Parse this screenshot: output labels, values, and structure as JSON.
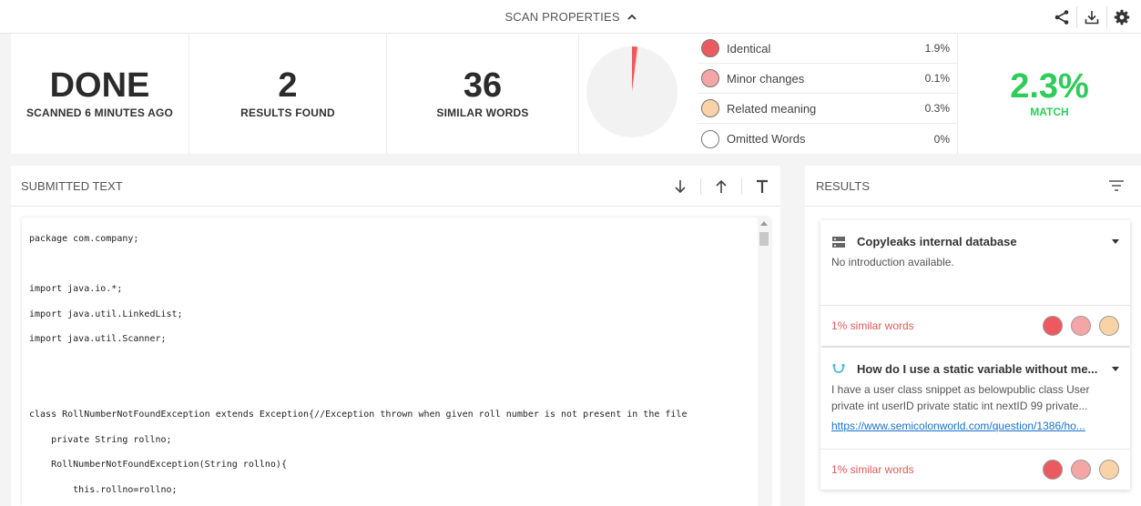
{
  "topbar": {
    "title": "SCAN PROPERTIES",
    "chevron_icon": "chevron-up-icon",
    "actions": [
      "share-icon",
      "download-icon",
      "gear-icon"
    ]
  },
  "stats": {
    "status": {
      "value": "DONE",
      "label": "SCANNED 6 MINUTES AGO"
    },
    "results": {
      "value": "2",
      "label": "RESULTS FOUND"
    },
    "words": {
      "value": "36",
      "label": "SIMILAR WORDS"
    },
    "match": {
      "value": "2.3%",
      "label": "MATCH",
      "color": "#2ecc5a"
    }
  },
  "chart_data": {
    "type": "pie",
    "categories": [
      "Identical",
      "Minor changes",
      "Related meaning",
      "Omitted Words"
    ],
    "values": [
      1.9,
      0.1,
      0.3,
      0
    ],
    "colors": [
      "#ec5a5f",
      "#f4a5a5",
      "#f8d3a6",
      "#ffffff"
    ],
    "title": ""
  },
  "legend": [
    {
      "label": "Identical",
      "pct": "1.9%",
      "color": "#ec5a5f"
    },
    {
      "label": "Minor changes",
      "pct": "0.1%",
      "color": "#f4a5a5"
    },
    {
      "label": "Related meaning",
      "pct": "0.3%",
      "color": "#f8d3a6"
    },
    {
      "label": "Omitted Words",
      "pct": "0%",
      "color": "#ffffff"
    }
  ],
  "submitted": {
    "title": "SUBMITTED TEXT",
    "tools": [
      "arrow-down-icon",
      "arrow-up-icon",
      "text-format-icon"
    ],
    "lines": [
      "package com.company;",
      "",
      "import java.io.*;",
      "import java.util.LinkedList;",
      "import java.util.Scanner;",
      "",
      "",
      "class RollNumberNotFoundException extends Exception{//Exception thrown when given roll number is not present in the file",
      "    private String rollno;",
      "    RollNumberNotFoundException(String rollno){",
      "        this.rollno=rollno;",
      "    }"
    ]
  },
  "results": {
    "title": "RESULTS",
    "cards": [
      {
        "title": "Copyleaks internal database",
        "icon": "database-icon",
        "desc": "No introduction available.",
        "link": "",
        "similar": "1% similar words"
      },
      {
        "title": "How do I use a static variable without me...",
        "icon": "web-source-icon",
        "desc": "I have a user class snippet as belowpublic class User private int userID private static int nextID 99 private...",
        "link": "https://www.semicolonworld.com/question/1386/ho...",
        "similar": "1% similar words"
      }
    ]
  }
}
